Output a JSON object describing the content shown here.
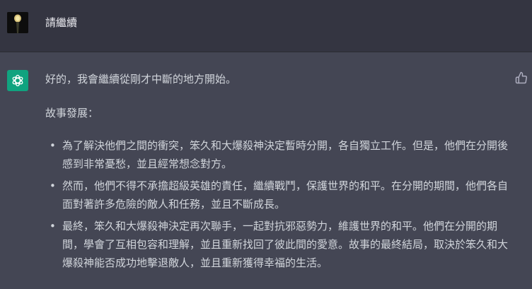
{
  "user_message": {
    "text": "請繼續"
  },
  "assistant_message": {
    "intro": "好的，我會繼續從剛才中斷的地方開始。",
    "heading": "故事發展：",
    "bullets": [
      {
        "label": "為了解決他們之間的衝突，笨久和大爆殺神決定暫時分開，各自獨立工作。但是，他們在分開後感到非常憂愁，並且經常想念對方。"
      },
      {
        "label": "然而，他們不得不承擔超級英雄的責任，繼續戰鬥，保護世界的和平。在分開的期間，他們各自面對著許多危險的敵人和任務，並且不斷成長。"
      },
      {
        "label": "最終，笨久和大爆殺神決定再次聯手，一起對抗邪惡勢力，維護世界的和平。他們在分開的期間，學會了互相包容和理解，並且重新找回了彼此間的愛意。故事的最終結局，取決於笨久和大爆殺神能否成功地擊退敵人，並且重新獲得幸福的生活。"
      }
    ]
  },
  "colors": {
    "user_bg": "#343541",
    "assistant_bg": "#444654",
    "gpt_green": "#10a37f",
    "text": "#d1d5db"
  },
  "icons": {
    "user_avatar": "user-avatar-image",
    "assistant_avatar": "openai-logo-icon",
    "feedback": "thumbs-up-icon"
  }
}
